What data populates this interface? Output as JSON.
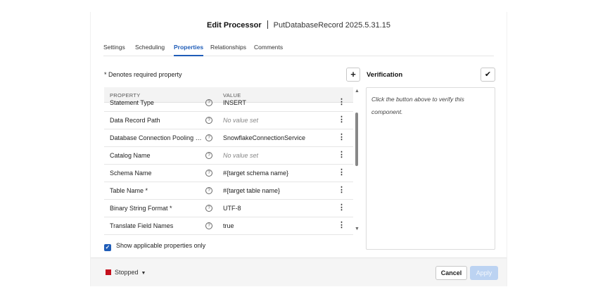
{
  "dialog": {
    "title": "Edit Processor",
    "subtitle": "PutDatabaseRecord 2025.5.31.15"
  },
  "tabs": [
    {
      "label": "Settings",
      "active": false
    },
    {
      "label": "Scheduling",
      "active": false
    },
    {
      "label": "Properties",
      "active": true
    },
    {
      "label": "Relationships",
      "active": false
    },
    {
      "label": "Comments",
      "active": false
    }
  ],
  "properties": {
    "required_note": "* Denotes required property",
    "add_button_label": "+",
    "columns": {
      "property": "PROPERTY",
      "value": "VALUE"
    },
    "rows": [
      {
        "name": "Statement Type",
        "value": "INSERT",
        "empty": false
      },
      {
        "name": "Data Record Path",
        "value": "No value set",
        "empty": true
      },
      {
        "name": "Database Connection Pooling Service",
        "value": "SnowflakeConnectionService",
        "empty": false
      },
      {
        "name": "Catalog Name",
        "value": "No value set",
        "empty": true
      },
      {
        "name": "Schema Name",
        "value": "#{target schema name}",
        "empty": false
      },
      {
        "name": "Table Name *",
        "value": "#{target table name}",
        "empty": false
      },
      {
        "name": "Binary String Format *",
        "value": "UTF-8",
        "empty": false
      },
      {
        "name": "Translate Field Names",
        "value": "true",
        "empty": false
      }
    ],
    "show_applicable_label": "Show applicable properties only",
    "show_applicable_checked": true
  },
  "verification": {
    "title": "Verification",
    "message": "Click the button above to verify this component."
  },
  "footer": {
    "status": "Stopped",
    "status_color": "#c4101d",
    "cancel_label": "Cancel",
    "apply_label": "Apply"
  },
  "colors": {
    "accent": "#1f5db8",
    "apply_disabled": "#bcd3f2"
  }
}
